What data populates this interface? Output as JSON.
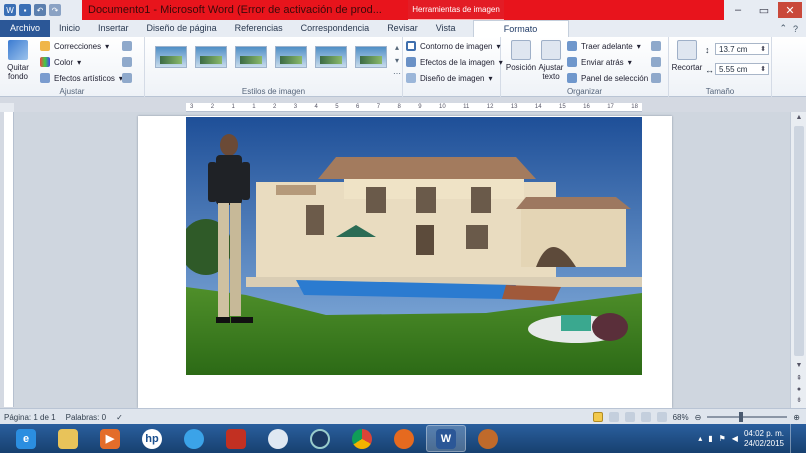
{
  "window": {
    "title": "Documento1 - Microsoft Word (Error de activación de prod...",
    "contextual_header": "Herramientas de imagen",
    "buttons": {
      "minimize": "–",
      "maximize": "▭",
      "close": "✕"
    }
  },
  "tabs": [
    {
      "label": "Archivo"
    },
    {
      "label": "Inicio"
    },
    {
      "label": "Insertar"
    },
    {
      "label": "Diseño de página"
    },
    {
      "label": "Referencias"
    },
    {
      "label": "Correspondencia"
    },
    {
      "label": "Revisar"
    },
    {
      "label": "Vista"
    },
    {
      "label": "Formato"
    }
  ],
  "ribbon": {
    "ajustar": {
      "label": "Ajustar",
      "remove_bg": "Quitar fondo",
      "correcciones": "Correcciones",
      "color": "Color",
      "efectos": "Efectos artísticos"
    },
    "estilos": {
      "label": "Estilos de imagen"
    },
    "imagen_opts": {
      "contorno": "Contorno de imagen",
      "efectos": "Efectos de la imagen",
      "diseno": "Diseño de imagen"
    },
    "organizar": {
      "label": "Organizar",
      "posicion": "Posición",
      "ajustar_texto": "Ajustar texto",
      "traer": "Traer adelante",
      "enviar": "Enviar atrás",
      "panel": "Panel de selección"
    },
    "tamano": {
      "label": "Tamaño",
      "recortar": "Recortar",
      "height": "13.7 cm",
      "width": "5.55 cm"
    }
  },
  "ruler_marks": [
    "3",
    "2",
    "1",
    "1",
    "2",
    "3",
    "4",
    "5",
    "6",
    "7",
    "8",
    "9",
    "10",
    "11",
    "12",
    "13",
    "14",
    "15",
    "16",
    "17",
    "18"
  ],
  "statusbar": {
    "page": "Página: 1 de 1",
    "words": "Palabras: 0",
    "zoom": "68%"
  },
  "taskbar": {
    "time": "04:02 p. m.",
    "date": "24/02/2015"
  }
}
